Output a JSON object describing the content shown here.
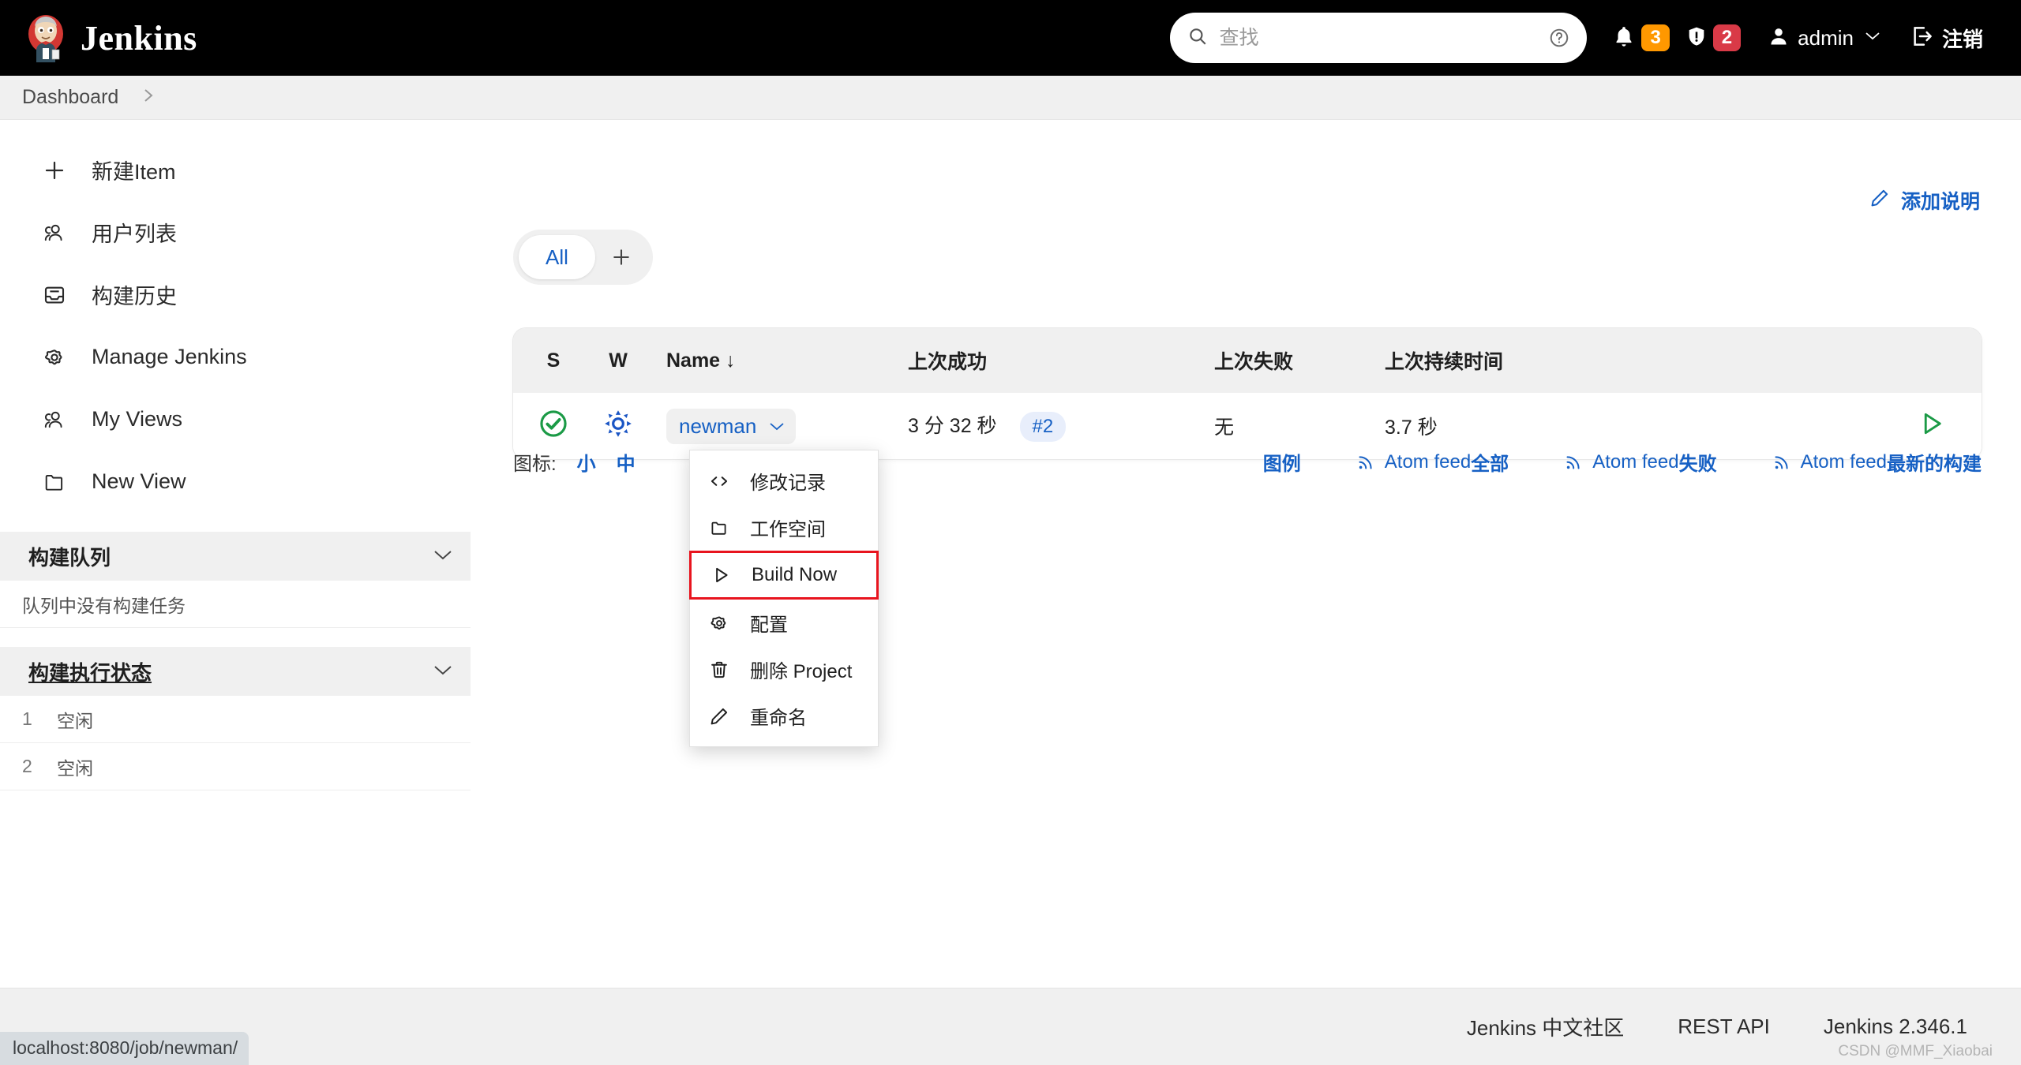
{
  "header": {
    "brand": "Jenkins",
    "search_placeholder": "查找",
    "search_value": "",
    "notification_count": "3",
    "error_count": "2",
    "user_name": "admin",
    "logout_label": "注销",
    "notification_color": "#FF9800",
    "error_color": "#D93A47"
  },
  "breadcrumb": {
    "home": "Dashboard"
  },
  "sidebar": {
    "items": [
      {
        "label": "新建Item",
        "icon": "plus-icon"
      },
      {
        "label": "用户列表",
        "icon": "people-icon"
      },
      {
        "label": "构建历史",
        "icon": "inbox-icon"
      },
      {
        "label": "Manage Jenkins",
        "icon": "gear-icon"
      },
      {
        "label": "My Views",
        "icon": "people-icon"
      },
      {
        "label": "New View",
        "icon": "folder-icon"
      }
    ],
    "build_queue": {
      "title": "构建队列",
      "empty_text": "队列中没有构建任务"
    },
    "executor_status": {
      "title": "构建执行状态",
      "executors": [
        {
          "num": "1",
          "state": "空闲"
        },
        {
          "num": "2",
          "state": "空闲"
        }
      ]
    }
  },
  "main": {
    "add_description": "添加说明",
    "tabs": {
      "all": "All",
      "add": "+"
    },
    "table": {
      "columns": [
        "S",
        "W",
        "Name ↓",
        "上次成功",
        "上次失败",
        "上次持续时间"
      ],
      "sort_indicator": "↓",
      "rows": [
        {
          "status": "success",
          "weather": "sunny",
          "name": "newman",
          "last_success": "3 分 32 秒",
          "last_success_build": "#2",
          "last_failure": "无",
          "last_duration": "3.7 秒"
        }
      ]
    },
    "icon_size": {
      "label": "图标:",
      "options": [
        "小",
        "中"
      ]
    },
    "feeds": {
      "legend": "图例",
      "items": [
        {
          "prefix": "Atom feed ",
          "suffix": "全部"
        },
        {
          "prefix": "Atom feed ",
          "suffix": "失败"
        },
        {
          "prefix": "Atom feed ",
          "suffix": "最新的构建"
        }
      ]
    }
  },
  "context_menu": {
    "items": [
      {
        "label": "修改记录",
        "icon": "code-icon",
        "highlighted": false
      },
      {
        "label": "工作空间",
        "icon": "folder-icon",
        "highlighted": false
      },
      {
        "label": "Build Now",
        "icon": "play-icon",
        "highlighted": true
      },
      {
        "label": "配置",
        "icon": "gear-icon",
        "highlighted": false
      },
      {
        "label": "删除 Project",
        "icon": "trash-icon",
        "highlighted": false
      },
      {
        "label": "重命名",
        "icon": "pencil-icon",
        "highlighted": false
      }
    ],
    "highlight_color": "#E8141E"
  },
  "footer": {
    "links": [
      "Jenkins 中文社区",
      "REST API",
      "Jenkins 2.346.1"
    ],
    "watermark": "CSDN @MMF_Xiaobai"
  },
  "statusbar": {
    "url": "localhost:8080/job/newman/"
  }
}
